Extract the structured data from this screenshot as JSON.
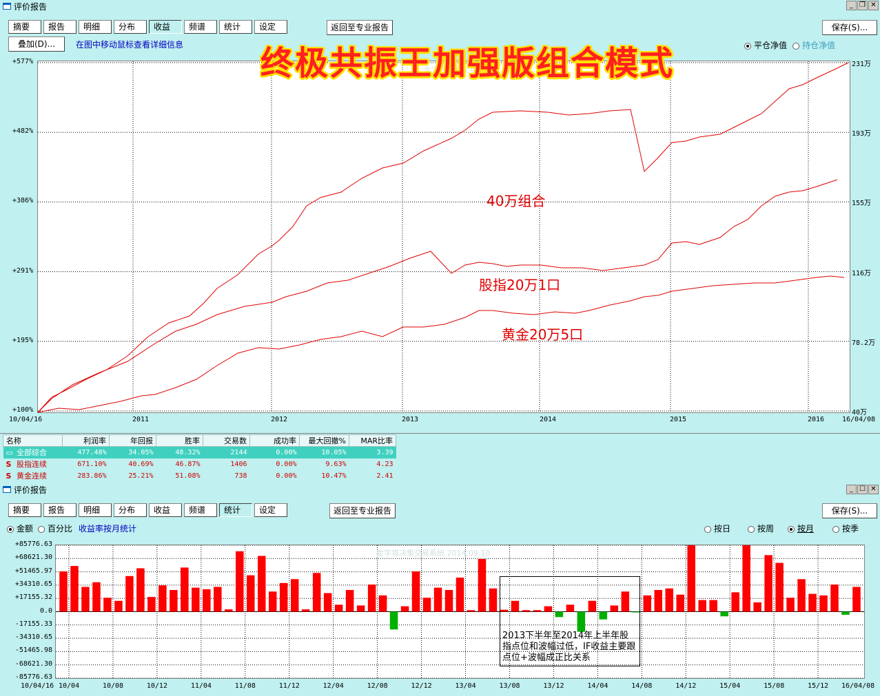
{
  "top_window": {
    "title": "评价报告",
    "tabs": [
      "摘要",
      "报告",
      "明细",
      "分布",
      "收益",
      "频谱",
      "统计",
      "设定"
    ],
    "active_tab": "收益",
    "back_button": "返回至专业报告",
    "save_button": "保存(S)...",
    "overlay_button": "叠加(D)...",
    "hint": "在图中移动鼠标查看详细信息",
    "radio_flat": "平仓净值",
    "radio_hold": "持仓净值",
    "overlay_title": "终极共振王加强版组合模式",
    "watermark": "金字塔决策交易系统"
  },
  "equity_chart": {
    "left_ticks": [
      "+577%",
      "+482%",
      "+386%",
      "+291%",
      "+195%",
      "+100%"
    ],
    "right_ticks": [
      "231万",
      "193万",
      "155万",
      "116万",
      "78.2万",
      "40万"
    ],
    "x_ticks": [
      "10/04/16",
      "2011",
      "2012",
      "2013",
      "2014",
      "2015",
      "2016",
      "16/04/08"
    ],
    "annotations": [
      "40万组合",
      "股指20万1口",
      "黄金20万5口"
    ],
    "line_color": "#e00000"
  },
  "stats_table": {
    "headers": [
      "名称",
      "利润率",
      "年回报",
      "胜率",
      "交易数",
      "成功率",
      "最大回撤%",
      "MAR比率"
    ],
    "rows": [
      {
        "name": "全部综合",
        "cells": [
          "477.48%",
          "34.05%",
          "48.32%",
          "2144",
          "0.00%",
          "10.05%",
          "3.39"
        ]
      },
      {
        "name": "股指连续",
        "cells": [
          "671.10%",
          "40.69%",
          "46.87%",
          "1406",
          "0.00%",
          "9.63%",
          "4.23"
        ]
      },
      {
        "name": "黄金连续",
        "cells": [
          "283.86%",
          "25.21%",
          "51.08%",
          "738",
          "0.00%",
          "10.47%",
          "2.41"
        ]
      }
    ]
  },
  "bottom_window": {
    "title": "评价报告",
    "tabs": [
      "摘要",
      "报告",
      "明细",
      "分布",
      "收益",
      "频谱",
      "统计",
      "设定"
    ],
    "active_tab": "统计",
    "back_button": "返回至专业报告",
    "save_button": "保存(S)...",
    "radio_amount": "金额",
    "radio_percent": "百分比",
    "hint": "收益率按月统计",
    "period_options": [
      "按日",
      "按周",
      "按月",
      "按季"
    ],
    "selected_period": "按月",
    "watermark": "金字塔决策交易系统 2014.09.10",
    "note": "2013下半年至2014年上半年股指点位和波幅过低，IF收益主要跟点位+波幅成正比关系"
  },
  "chart_data": {
    "type": "bar",
    "title": "",
    "y_ticks": [
      "+85776.63",
      "+68621.30",
      "+51465.97",
      "+34310.65",
      "+17155.32",
      "0.0",
      "-17155.33",
      "-34310.65",
      "-51465.98",
      "-68621.30",
      "-85776.63"
    ],
    "ylim": [
      -85776.63,
      85776.63
    ],
    "x_ticks": [
      "10/04/16",
      "10/04",
      "10/08",
      "10/12",
      "11/04",
      "11/08",
      "11/12",
      "12/04",
      "12/08",
      "12/12",
      "13/04",
      "13/08",
      "13/12",
      "14/04",
      "14/08",
      "14/12",
      "15/04",
      "15/08",
      "15/12",
      "16/04/08"
    ],
    "positive_color": "#ff0000",
    "negative_color": "#00b000",
    "values": [
      52000,
      59000,
      32000,
      38000,
      18000,
      14000,
      46000,
      56000,
      19000,
      34000,
      28000,
      57000,
      31000,
      29000,
      32000,
      3000,
      78000,
      47000,
      72000,
      26000,
      37000,
      42000,
      3000,
      50000,
      24000,
      9000,
      28000,
      8000,
      35000,
      21000,
      -23000,
      7000,
      52000,
      18000,
      31000,
      28000,
      44000,
      2000,
      68000,
      30000,
      2500,
      14000,
      2000,
      2000,
      7000,
      -7000,
      9000,
      -26000,
      14000,
      -10000,
      8000,
      26000,
      -1000,
      21000,
      28000,
      30000,
      22000,
      86000,
      15000,
      15000,
      -6000,
      25000,
      86000,
      12000,
      73000,
      63000,
      18000,
      42000,
      23000,
      21000,
      35000,
      -4000,
      32000
    ]
  }
}
